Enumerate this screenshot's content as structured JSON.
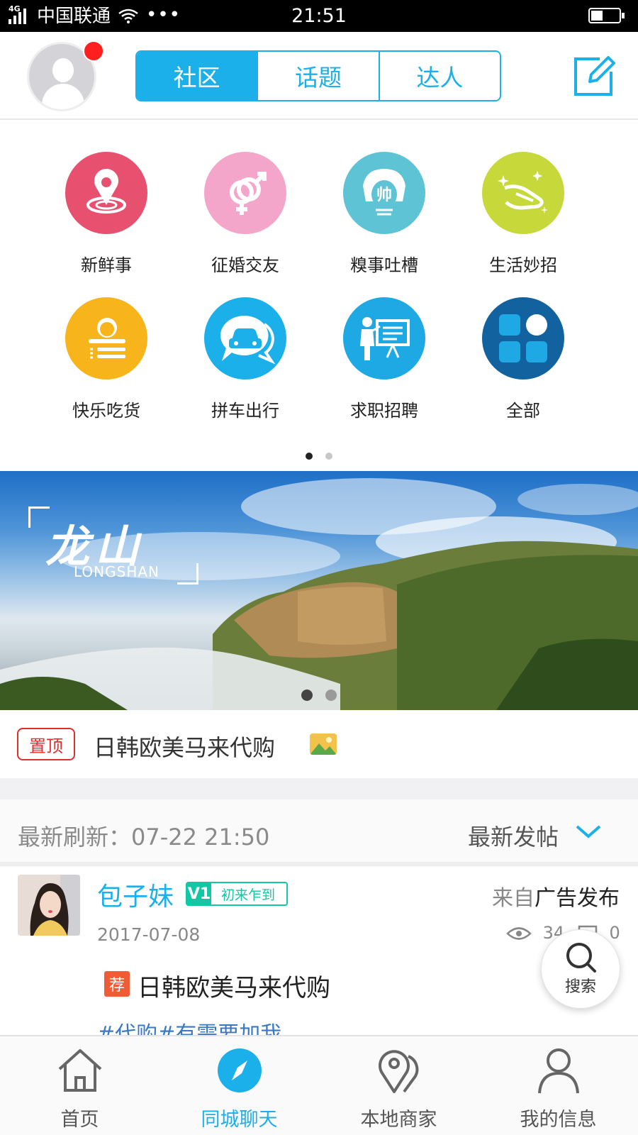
{
  "status_bar": {
    "network": "4G",
    "carrier": "中国联通",
    "more": "•••",
    "time": "21:51"
  },
  "top_nav": {
    "tabs": [
      {
        "label": "社区",
        "active": true
      },
      {
        "label": "话题",
        "active": false
      },
      {
        "label": "达人",
        "active": false
      }
    ],
    "icons": {
      "avatar": "user-avatar-icon",
      "compose": "edit-icon"
    },
    "accent": "#1cb0ea",
    "notification_dot_color": "#ff1f1f"
  },
  "categories": [
    {
      "label": "新鲜事",
      "icon": "location-pin-icon",
      "color": "#e8506f"
    },
    {
      "label": "征婚交友",
      "icon": "gender-symbol-icon",
      "color": "#f3a6c9"
    },
    {
      "label": "糗事吐槽",
      "icon": "handsome-face-icon",
      "color": "#5ec3d5",
      "glyph": "帅"
    },
    {
      "label": "生活妙招",
      "icon": "sparkle-hand-icon",
      "color": "#c7d93a"
    },
    {
      "label": "快乐吃货",
      "icon": "food-plate-icon",
      "color": "#f7b41b"
    },
    {
      "label": "拼车出行",
      "icon": "car-chat-icon",
      "color": "#1cb0ea"
    },
    {
      "label": "求职招聘",
      "icon": "presentation-icon",
      "color": "#1fa9e4"
    },
    {
      "label": "全部",
      "icon": "apps-grid-icon",
      "color": "#11629e"
    }
  ],
  "category_pager": {
    "pages": 2,
    "current": 1
  },
  "banner": {
    "title_cn": "龙山",
    "title_en": "LONGSHAN",
    "pages": 2,
    "current": 1
  },
  "pinned": {
    "tag": "置顶",
    "title": "日韩欧美马来代购",
    "image_icon": "image-icon"
  },
  "feed_header": {
    "refresh_label": "最新刷新：07-22 21:50",
    "sort_label": "最新发帖",
    "sort_icon": "chevron-down-icon"
  },
  "post": {
    "username": "包子妹",
    "level_badge": "V1",
    "level_text": "初来乍到",
    "from_prefix": "来自",
    "from_source": "广告发布",
    "date": "2017-07-08",
    "views": "34",
    "comments": "0",
    "rec_tag": "荐",
    "title": "日韩欧美马来代购",
    "tags_line": "#代购#有需要加我"
  },
  "fab": {
    "label": "搜索",
    "icon": "search-icon"
  },
  "bottom_nav": [
    {
      "label": "首页",
      "icon": "home-icon",
      "active": false
    },
    {
      "label": "同城聊天",
      "icon": "compass-icon",
      "active": true
    },
    {
      "label": "本地商家",
      "icon": "map-pin-icon",
      "active": false
    },
    {
      "label": "我的信息",
      "icon": "person-icon",
      "active": false
    }
  ]
}
